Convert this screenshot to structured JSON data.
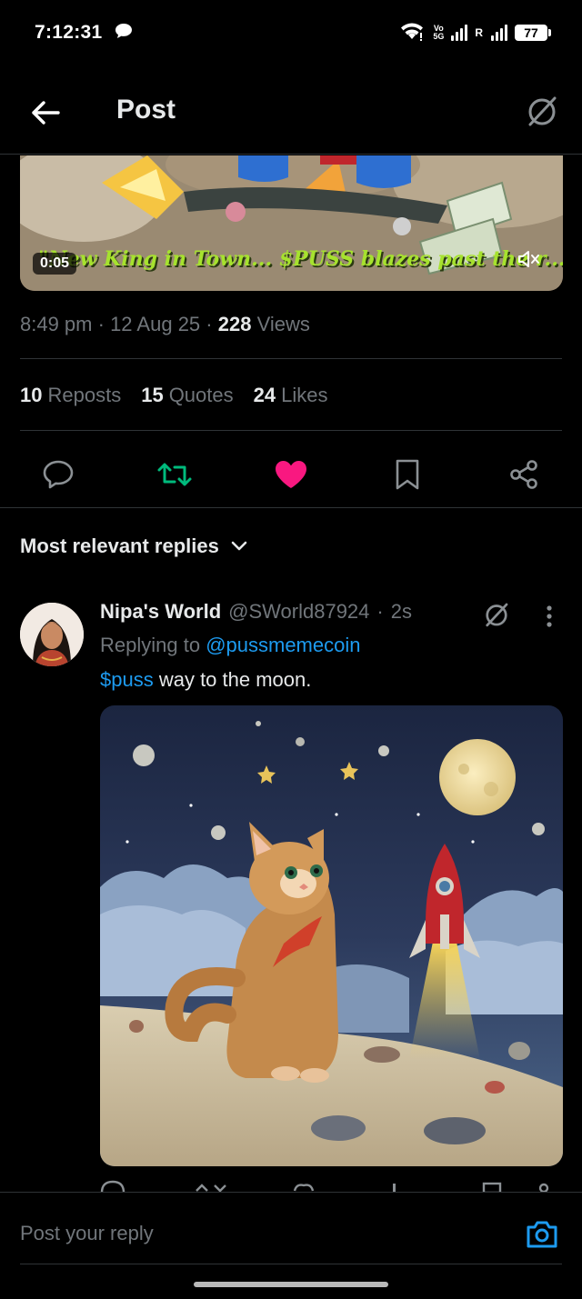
{
  "status_bar": {
    "time": "7:12:31",
    "volte_top": "Vo",
    "volte_bottom": "5G",
    "roaming": "R",
    "battery": "77",
    "icons": [
      "chat-bubble-icon",
      "wifi-icon",
      "signal-icon",
      "battery-icon"
    ]
  },
  "header": {
    "title": "Post",
    "back_icon": "arrow-left-icon",
    "grok_icon": "grok-icon"
  },
  "video": {
    "duration": "0:05",
    "caption": "\"New King in Town... $PUSS blazes past the r...!",
    "mute_icon": "speaker-muted-icon"
  },
  "post_meta": {
    "time": "8:49 pm",
    "sep1": " · ",
    "date": "12 Aug 25",
    "sep2": " · ",
    "views_count": "228",
    "views_label": "Views"
  },
  "stats": {
    "reposts_count": "10",
    "reposts_label": "Reposts",
    "quotes_count": "15",
    "quotes_label": "Quotes",
    "likes_count": "24",
    "likes_label": "Likes"
  },
  "colors": {
    "repost_active": "#00ba7c",
    "like_active": "#f91880",
    "link": "#1d9bf0",
    "muted_text": "#71767b"
  },
  "sort": {
    "label": "Most relevant replies"
  },
  "reply": {
    "name": "Nipa's World",
    "handle": "@SWorld87924",
    "sep": "·",
    "time": "2s",
    "replying_prefix": "Replying to ",
    "replying_handle": "@pussmemecoin",
    "text_tag": "$puss",
    "text_rest": " way to the moon."
  },
  "compose": {
    "placeholder": "Post your reply",
    "camera_icon": "camera-icon"
  }
}
